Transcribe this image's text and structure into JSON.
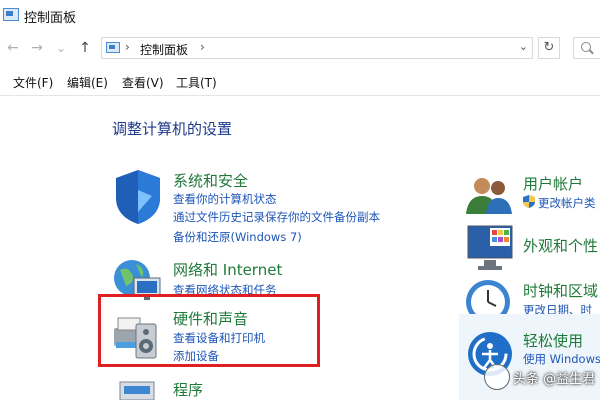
{
  "window": {
    "title": "控制面板"
  },
  "address": {
    "path": "控制面板",
    "separator": "›",
    "dropdown_icon": "chevron-down-icon",
    "refresh_icon": "refresh-icon"
  },
  "nav": {
    "back": "←",
    "forward": "→",
    "recent": "⌄",
    "up": "↑"
  },
  "menu": {
    "file": "文件(F)",
    "edit": "编辑(E)",
    "view": "查看(V)",
    "tools": "工具(T)"
  },
  "main": {
    "heading": "调整计算机的设置",
    "categories": [
      {
        "title": "系统和安全",
        "links": [
          "查看你的计算机状态",
          "通过文件历史记录保存你的文件备份副本",
          "备份和还原(Windows 7)"
        ]
      },
      {
        "title": "网络和 Internet",
        "links": [
          "查看网络状态和任务"
        ]
      },
      {
        "title": "硬件和声音",
        "links": [
          "查看设备和打印机",
          "添加设备"
        ]
      },
      {
        "title": "程序",
        "links": []
      }
    ],
    "right_categories": [
      {
        "title": "用户帐户",
        "links": [
          "更改帐户类"
        ]
      },
      {
        "title": "外观和个性",
        "links": []
      },
      {
        "title": "时钟和区域",
        "links": [
          "更改日期、时"
        ]
      },
      {
        "title": "轻松使用",
        "links": [
          "使用 Windows"
        ]
      }
    ]
  },
  "watermark": {
    "text": "头条 @益生君"
  },
  "colors": {
    "category_title": "#1f7a3a",
    "link": "#1e56b8",
    "heading": "#1e3a8a",
    "highlight": "#e02020"
  }
}
